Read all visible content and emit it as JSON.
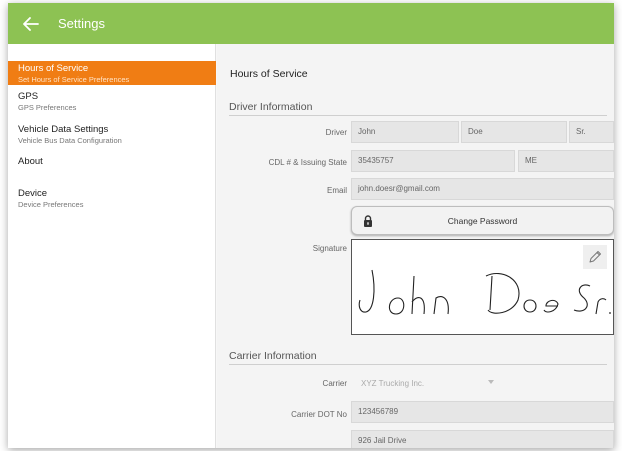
{
  "app": {
    "title": "Settings"
  },
  "sidebar": {
    "items": [
      {
        "title": "Hours of Service",
        "subtitle": "Set Hours of Service Preferences"
      },
      {
        "title": "GPS",
        "subtitle": "GPS Preferences"
      },
      {
        "title": "Vehicle Data Settings",
        "subtitle": "Vehicle Bus Data Configuration"
      },
      {
        "title": "About",
        "subtitle": ""
      },
      {
        "title": "Device",
        "subtitle": "Device Preferences"
      }
    ]
  },
  "main": {
    "title": "Hours of Service",
    "driver_section": {
      "heading": "Driver Information",
      "driver_label": "Driver",
      "first_name": "John",
      "last_name": "Doe",
      "suffix": "Sr.",
      "cdl_label": "CDL # & Issuing State",
      "cdl_number": "35435757",
      "cdl_state": "ME",
      "email_label": "Email",
      "email": "john.doesr@gmail.com",
      "change_password_label": "Change Password",
      "signature_label": "Signature",
      "signature_text": "John Doe Sr."
    },
    "carrier_section": {
      "heading": "Carrier Information",
      "carrier_label": "Carrier",
      "carrier_value": "XYZ Trucking Inc.",
      "dot_label": "Carrier DOT No",
      "dot_value": "123456789",
      "address_value": "926 Jail Drive"
    }
  },
  "colors": {
    "appbar": "#8dc253",
    "active_item": "#f07d14"
  }
}
